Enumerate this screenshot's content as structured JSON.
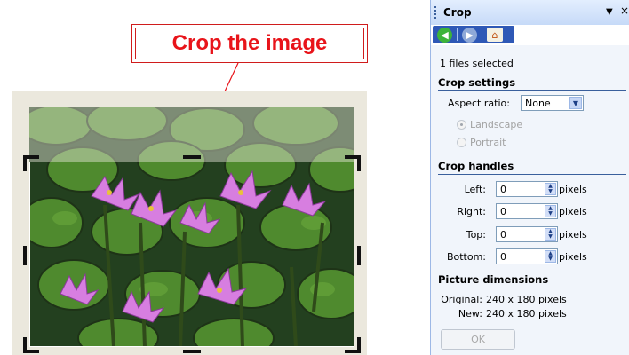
{
  "callout": {
    "text": "Crop the image",
    "color": "#e8141a"
  },
  "pane": {
    "title": "Crop",
    "nav": {
      "back_icon": "back-arrow-icon",
      "forward_icon": "forward-arrow-icon",
      "home_icon": "home-icon"
    },
    "files_selected": "1 files selected",
    "crop_settings": {
      "title": "Crop settings",
      "aspect_label": "Aspect ratio:",
      "aspect_value": "None",
      "landscape": "Landscape",
      "portrait": "Portrait"
    },
    "crop_handles": {
      "title": "Crop handles",
      "unit": "pixels",
      "left_label": "Left:",
      "left_value": "0",
      "right_label": "Right:",
      "right_value": "0",
      "top_label": "Top:",
      "top_value": "0",
      "bottom_label": "Bottom:",
      "bottom_value": "0"
    },
    "dimensions": {
      "title": "Picture dimensions",
      "original_label": "Original:",
      "original_value": "240 x 180 pixels",
      "new_label": "New:",
      "new_value": "240 x 180 pixels"
    },
    "ok_label": "OK",
    "colors": {
      "header": "#c6daf8",
      "nav": "#2e58b6",
      "body": "#f1f5fb"
    }
  }
}
